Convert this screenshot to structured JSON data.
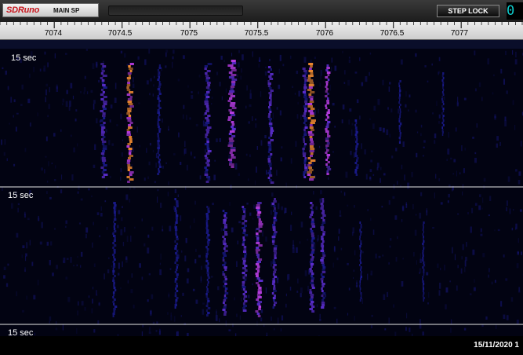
{
  "titlebar": {
    "app_name": "SDRuno",
    "window_label": "MAIN SP",
    "step_lock_label": "STEP LOCK",
    "lcd_value": "0",
    "logo_color": "#c8161d",
    "lcd_color": "#0ec9c9"
  },
  "frequency_scale": {
    "labels": [
      "7074",
      "7074.5",
      "7075",
      "7075.5",
      "7076",
      "7076.5",
      "7077"
    ]
  },
  "waterfall": {
    "time_markers": [
      "15 sec",
      "15 sec",
      "15 sec"
    ],
    "palette": [
      "#1a1a8c",
      "#5a2dcc",
      "#b53ce0",
      "#f08a30"
    ]
  },
  "statusbar": {
    "date": "15/11/2020 1"
  }
}
